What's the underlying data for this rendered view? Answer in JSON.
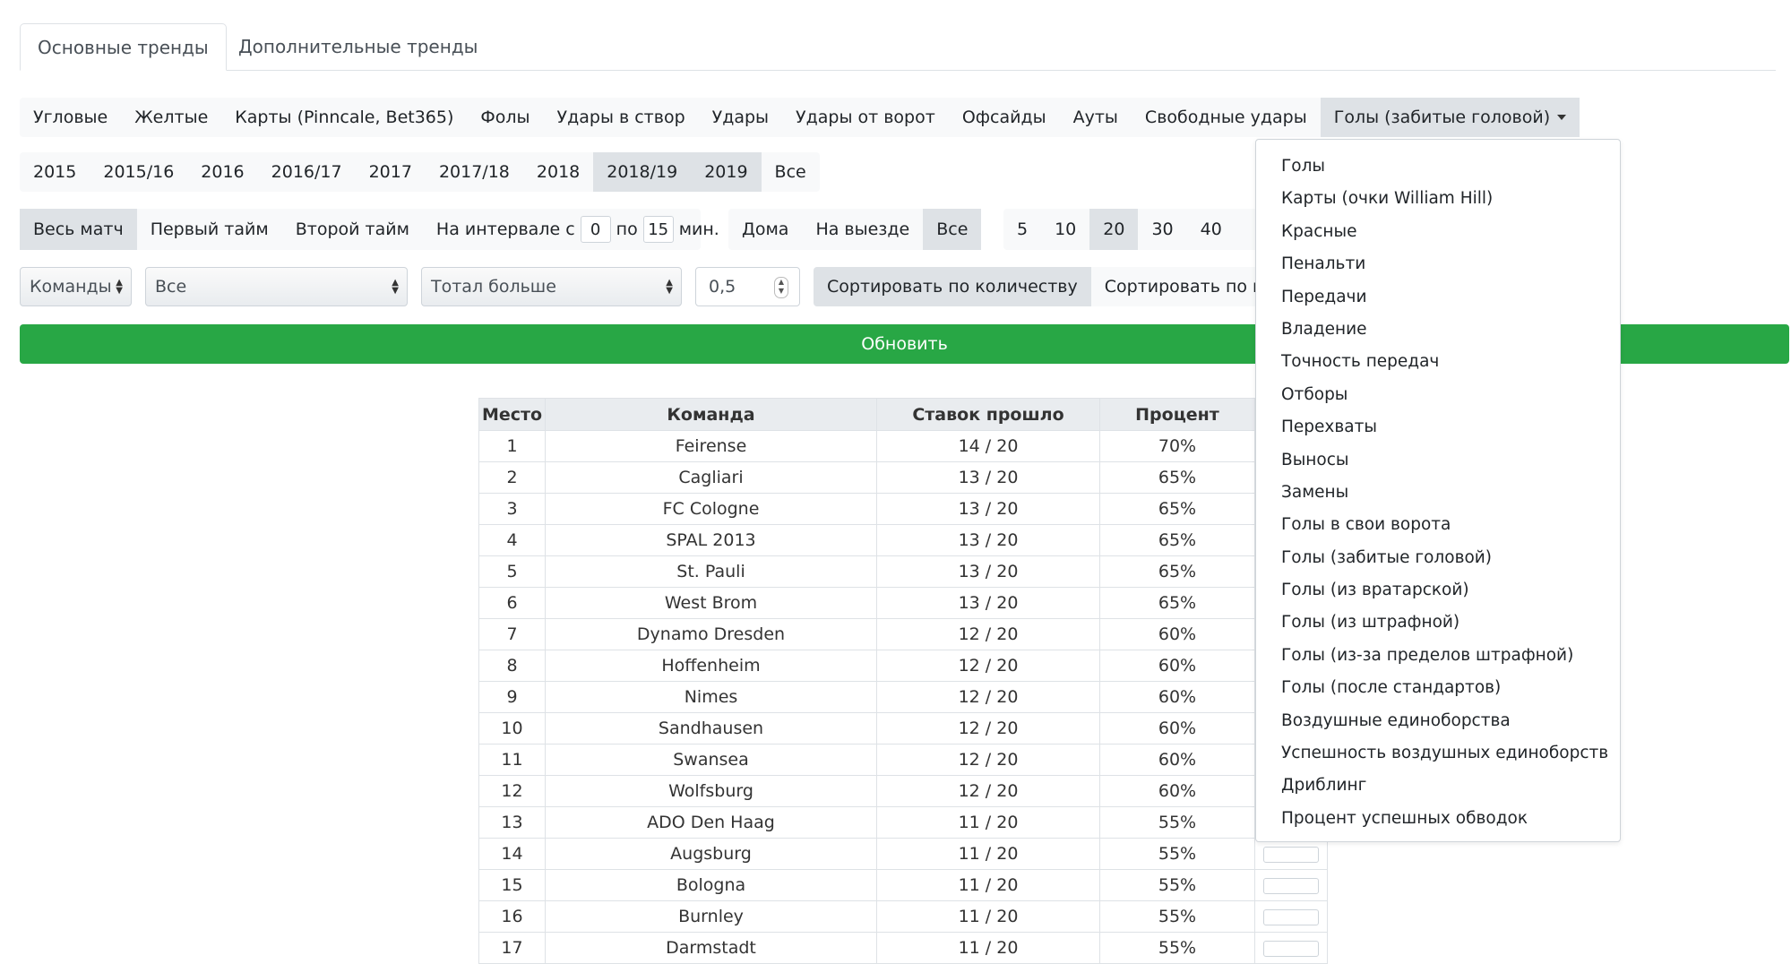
{
  "tabs": [
    "Основные тренды",
    "Дополнительные тренды"
  ],
  "stat_types": [
    "Угловые",
    "Желтые",
    "Карты (Pinncale, Bet365)",
    "Фолы",
    "Удары в створ",
    "Удары",
    "Удары от ворот",
    "Офсайды",
    "Ауты",
    "Свободные удары"
  ],
  "stat_dropdown_label": "Голы (забитые головой)",
  "seasons": [
    "2015",
    "2015/16",
    "2016",
    "2016/17",
    "2017",
    "2017/18",
    "2018",
    "2018/19",
    "2019",
    "Все"
  ],
  "periods": {
    "full": "Весь матч",
    "first": "Первый тайм",
    "second": "Второй тайм",
    "interval_prefix": "На интервале с",
    "from_value": "0",
    "to_label": "по",
    "to_value": "15",
    "unit": "мин."
  },
  "venue": [
    "Дома",
    "На выезде",
    "Все"
  ],
  "last_n": [
    "5",
    "10",
    "20",
    "30",
    "40"
  ],
  "filters": {
    "entity": "Команды",
    "team": "Все",
    "bet_type": "Тотал больше",
    "threshold": "0,5",
    "sort_by_count": "Сортировать по количеству",
    "sort_by_percent": "Сортировать по пр"
  },
  "update_button": "Обновить",
  "table": {
    "headers": [
      "Место",
      "Команда",
      "Ставок прошло",
      "Процент"
    ],
    "rows": [
      [
        "1",
        "Feirense",
        "14 / 20",
        "70%"
      ],
      [
        "2",
        "Cagliari",
        "13 / 20",
        "65%"
      ],
      [
        "3",
        "FC Cologne",
        "13 / 20",
        "65%"
      ],
      [
        "4",
        "SPAL 2013",
        "13 / 20",
        "65%"
      ],
      [
        "5",
        "St. Pauli",
        "13 / 20",
        "65%"
      ],
      [
        "6",
        "West Brom",
        "13 / 20",
        "65%"
      ],
      [
        "7",
        "Dynamo Dresden",
        "12 / 20",
        "60%"
      ],
      [
        "8",
        "Hoffenheim",
        "12 / 20",
        "60%"
      ],
      [
        "9",
        "Nimes",
        "12 / 20",
        "60%"
      ],
      [
        "10",
        "Sandhausen",
        "12 / 20",
        "60%"
      ],
      [
        "11",
        "Swansea",
        "12 / 20",
        "60%"
      ],
      [
        "12",
        "Wolfsburg",
        "12 / 20",
        "60%"
      ],
      [
        "13",
        "ADO Den Haag",
        "11 / 20",
        "55%"
      ],
      [
        "14",
        "Augsburg",
        "11 / 20",
        "55%"
      ],
      [
        "15",
        "Bologna",
        "11 / 20",
        "55%"
      ],
      [
        "16",
        "Burnley",
        "11 / 20",
        "55%"
      ],
      [
        "17",
        "Darmstadt",
        "11 / 20",
        "55%"
      ]
    ]
  },
  "dropdown_items": [
    "Голы",
    "Карты (очки William Hill)",
    "Красные",
    "Пенальти",
    "Передачи",
    "Владение",
    "Точность передач",
    "Отборы",
    "Перехваты",
    "Выносы",
    "Замены",
    "Голы в свои ворота",
    "Голы (забитые головой)",
    "Голы (из вратарской)",
    "Голы (из штрафной)",
    "Голы (из-за пределов штрафной)",
    "Голы (после стандартов)",
    "Воздушные единоборства",
    "Успешность воздушных единоборств",
    "Дриблинг",
    "Процент успешных обводок"
  ],
  "colors": {
    "success": "#28a745",
    "selected": "#dee2e6",
    "bar_bg": "#f8f9fa"
  }
}
